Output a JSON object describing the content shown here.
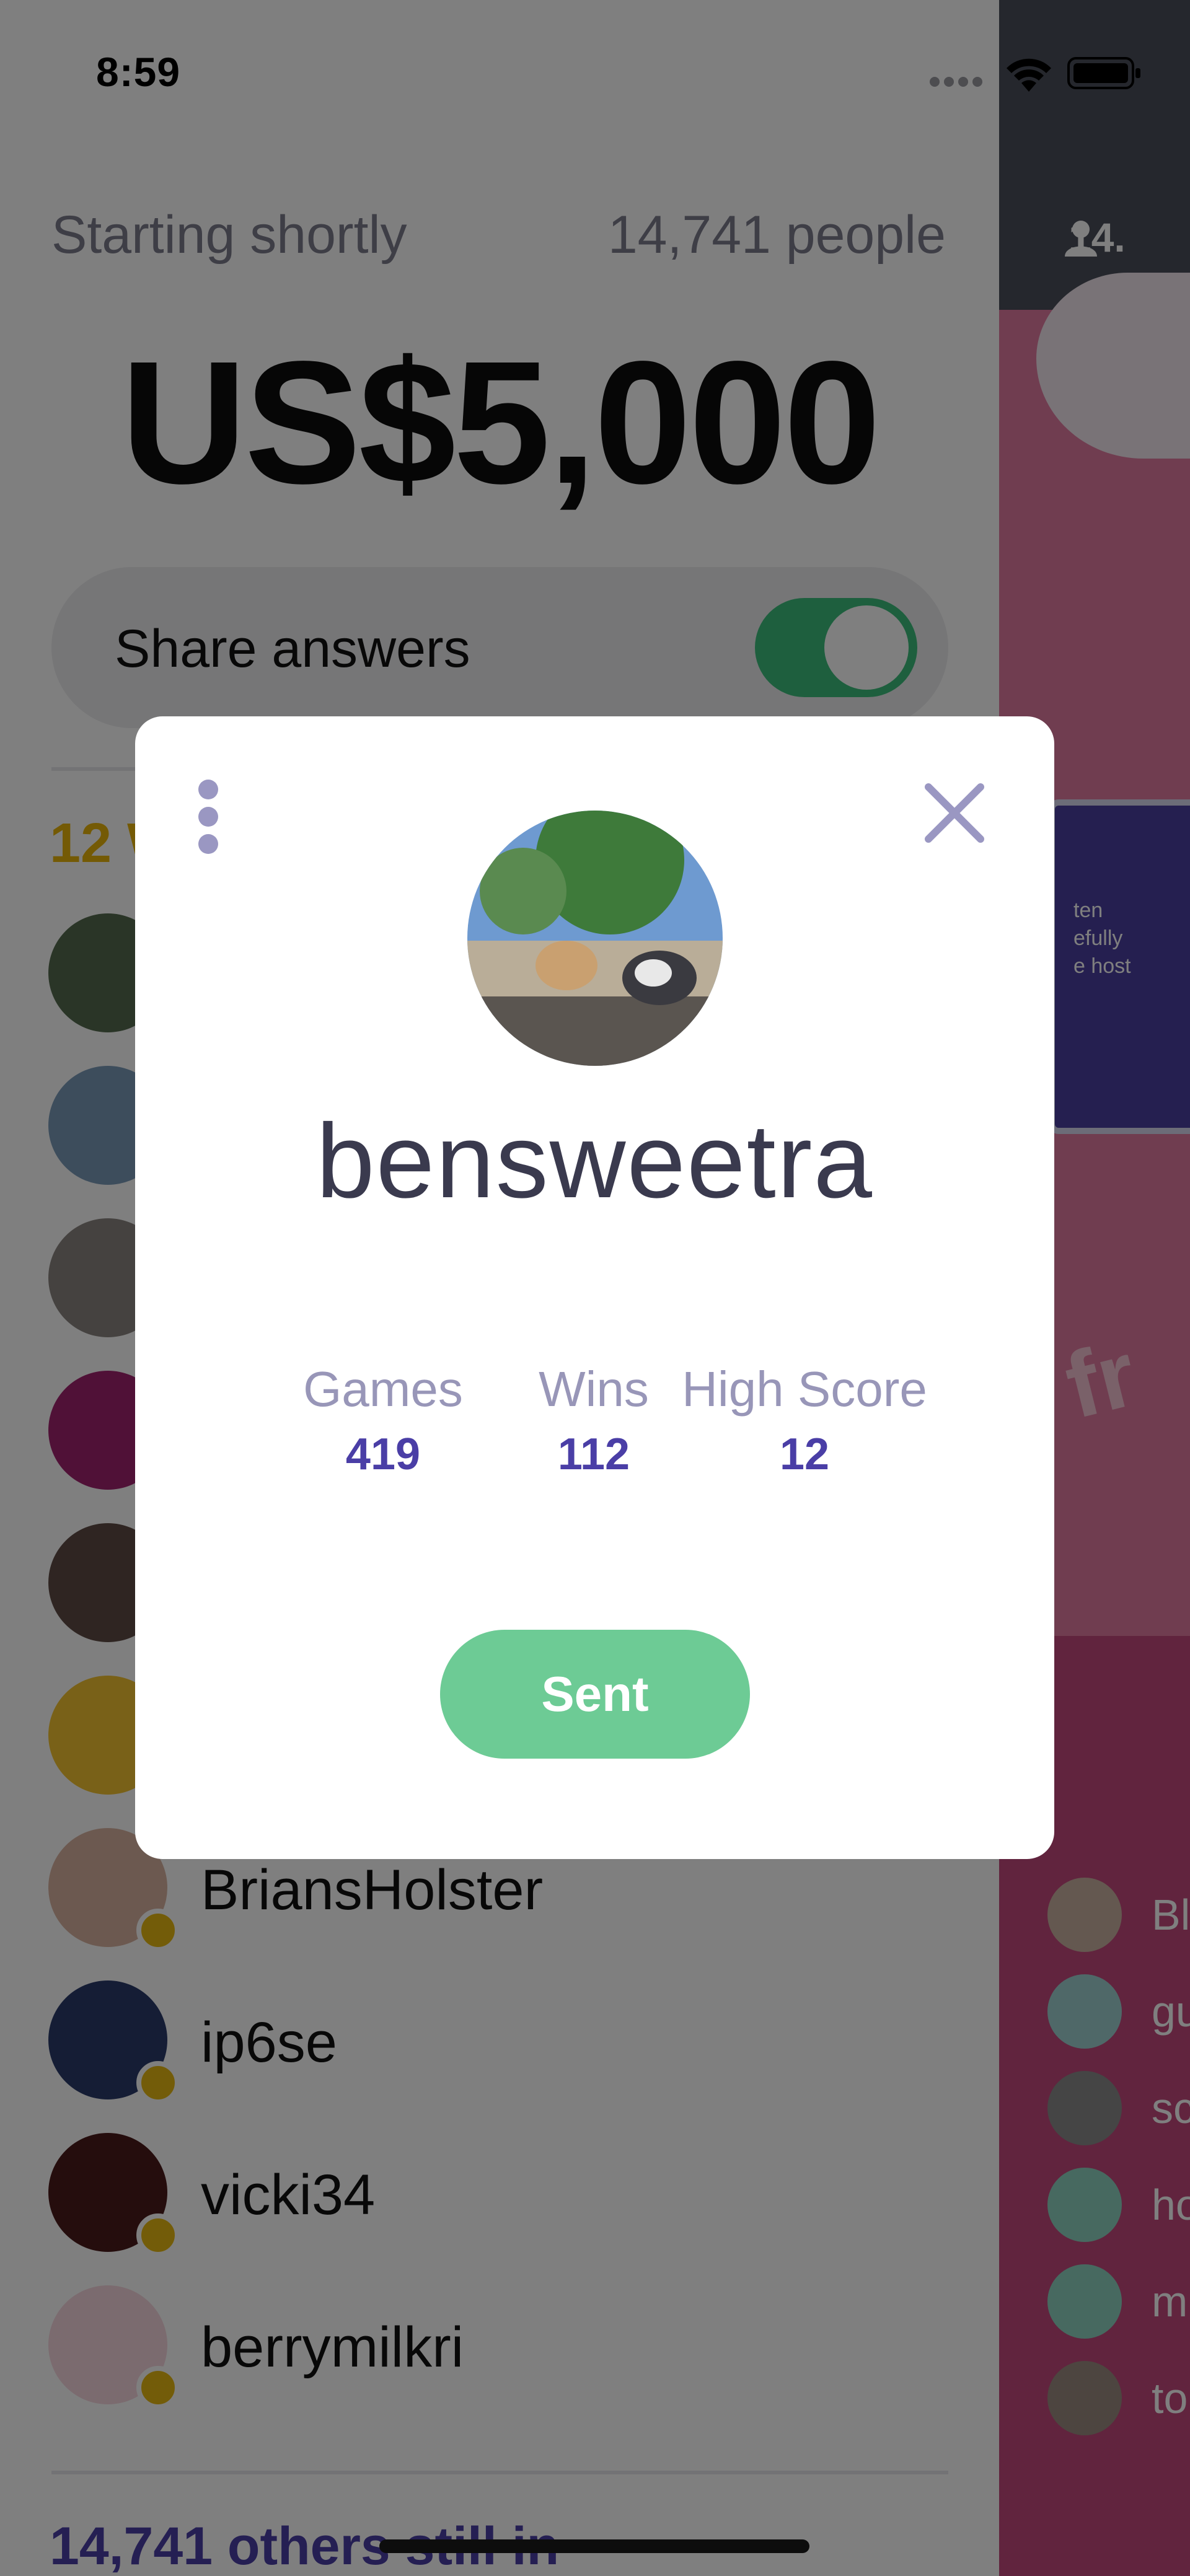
{
  "status_bar": {
    "time": "8:59"
  },
  "lobby": {
    "status_text": "Starting shortly",
    "people_count": "14,741 people",
    "prize": "US$5,000",
    "share_answers_label": "Share answers",
    "share_answers_on": true,
    "winners_label": "12 W",
    "others_label": "14,741 others still in"
  },
  "players": [
    {
      "name": "",
      "avatar_color": "#556b4e"
    },
    {
      "name": "",
      "avatar_color": "#7a9ab8"
    },
    {
      "name": "",
      "avatar_color": "#8a8580"
    },
    {
      "name": "",
      "avatar_color": "#a0236e"
    },
    {
      "name": "",
      "avatar_color": "#5e4a44"
    },
    {
      "name": "",
      "avatar_color": "#f2c230"
    },
    {
      "name": "BriansHolster",
      "avatar_color": "#d8b3a0"
    },
    {
      "name": "ip6se",
      "avatar_color": "#2a3a6a"
    },
    {
      "name": "vicki34",
      "avatar_color": "#4a1a1a"
    },
    {
      "name": "berrymilkri",
      "avatar_color": "#f6d6de"
    }
  ],
  "side_panel": {
    "viewer_count": "14.",
    "card_lines": [
      "ten",
      "efully",
      "e host"
    ],
    "deco_text": "fr",
    "chatters": [
      {
        "name": "Bl",
        "avatar_color": "#c9b0a0"
      },
      {
        "name": "gu",
        "avatar_color": "#9fd0d0"
      },
      {
        "name": "sc",
        "avatar_color": "#8a8a8a"
      },
      {
        "name": "ho",
        "avatar_color": "#8fd3c0"
      },
      {
        "name": "m",
        "avatar_color": "#8fd3c0"
      },
      {
        "name": "to",
        "avatar_color": "#9a8a80"
      }
    ]
  },
  "profile_modal": {
    "username": "bensweetra",
    "stats": {
      "games_label": "Games",
      "games_value": "419",
      "wins_label": "Wins",
      "wins_value": "112",
      "high_score_label": "High Score",
      "high_score_value": "12"
    },
    "action_button": "Sent"
  }
}
